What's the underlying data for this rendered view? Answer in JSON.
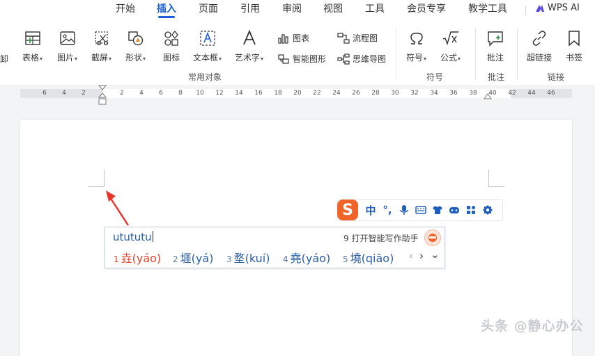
{
  "menu": {
    "tabs": [
      {
        "label": "开始"
      },
      {
        "label": "插入"
      },
      {
        "label": "页面"
      },
      {
        "label": "引用"
      },
      {
        "label": "审阅"
      },
      {
        "label": "视图"
      },
      {
        "label": "工具"
      },
      {
        "label": "会员专享"
      },
      {
        "label": "教学工具"
      }
    ],
    "active_tab": "插入",
    "wps_ai_label": "WPS AI"
  },
  "ribbon": {
    "cut_off_label": "卸",
    "table_label": "表格",
    "picture_label": "图片",
    "screenshot_label": "截屏",
    "shape_label": "形状",
    "icon_label": "图标",
    "textbox_label": "文本框",
    "wordart_label": "艺术字",
    "chart_label": "图表",
    "smart_graphic_label": "智能图形",
    "flowchart_label": "流程图",
    "mindmap_label": "思维导图",
    "common_objects_group": "常用对象",
    "symbol_label": "符号",
    "formula_label": "公式",
    "symbol_group": "符号",
    "comment_label": "批注",
    "comment_group": "批注",
    "hyperlink_label": "超链接",
    "bookmark_label": "书签",
    "link_group": "链接"
  },
  "ruler": {
    "left_ticks": [
      "6",
      "4",
      "2"
    ],
    "right_ticks": [
      "2",
      "4",
      "6",
      "8",
      "10",
      "12",
      "14",
      "16",
      "18",
      "20",
      "22",
      "24",
      "26",
      "28",
      "30",
      "32",
      "34",
      "36",
      "38",
      "40",
      "42",
      "44",
      "46"
    ]
  },
  "ime": {
    "input_text": "utututu",
    "assist_text": "9 打开智能写作助手",
    "logo_letter": "S",
    "toolbar_mode": "中",
    "toolbar_punct": "°,",
    "candidates": [
      {
        "num": "1",
        "text": "垚(yáo)"
      },
      {
        "num": "2",
        "text": "堐(yá)"
      },
      {
        "num": "3",
        "text": "堥(kuí)"
      },
      {
        "num": "4",
        "text": "堯(yáo)"
      },
      {
        "num": "5",
        "text": "墝(qiāo)"
      }
    ],
    "prev": "‹",
    "next": "›",
    "expand": "⌄"
  },
  "watermark": "头条 @静心办公",
  "colors": {
    "accent": "#1a5fd8",
    "sogou_orange": "#f0642a",
    "candidate_blue": "#2b5fa8",
    "candidate_red": "#e5432a",
    "arrow_red": "#e8352b"
  }
}
